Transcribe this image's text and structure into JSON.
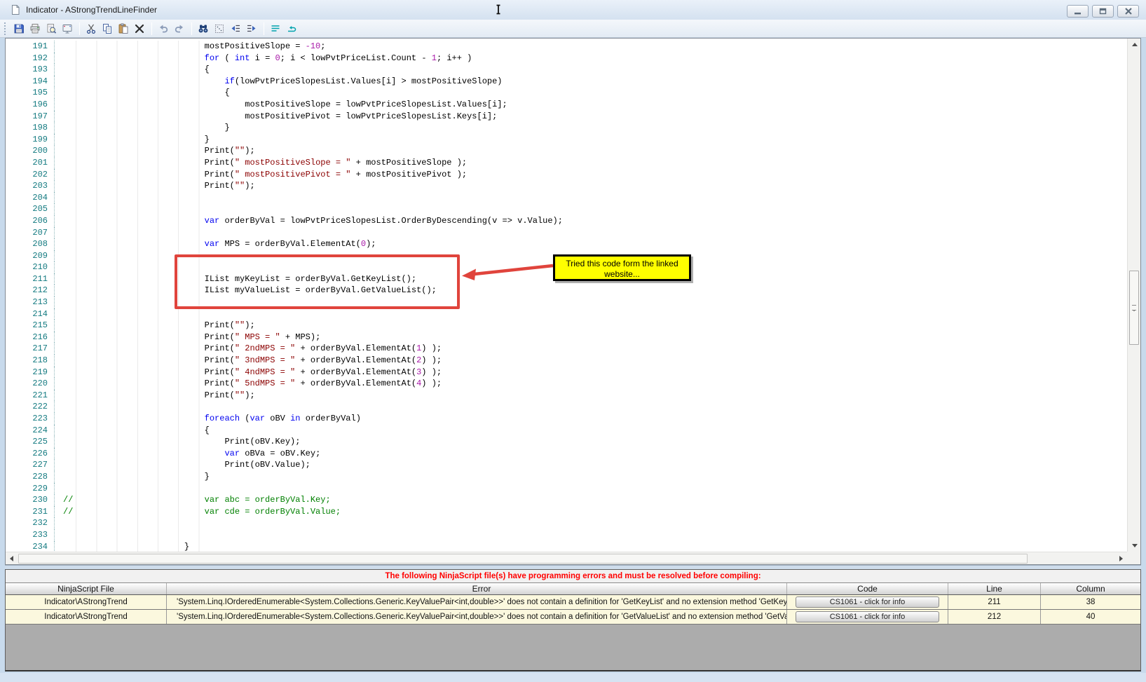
{
  "window": {
    "title": "Indicator - AStrongTrendLineFinder"
  },
  "toolbar": {
    "icons": [
      "save",
      "print",
      "print-preview",
      "board",
      "cut",
      "copy",
      "paste",
      "delete",
      "undo",
      "redo",
      "find",
      "select-special",
      "outdent",
      "indent",
      "align-lines",
      "wrap-return"
    ]
  },
  "editor": {
    "first_visible_line": 191,
    "last_visible_line": 234,
    "lines": [
      {
        "n": "191",
        "s": [
          [
            "p",
            "                            mostPositiveSlope = "
          ],
          [
            "n",
            "-10"
          ],
          [
            "p",
            ";"
          ]
        ]
      },
      {
        "n": "192",
        "s": [
          [
            "p",
            "                            "
          ],
          [
            "k",
            "for"
          ],
          [
            "p",
            " ( "
          ],
          [
            "k",
            "int"
          ],
          [
            "p",
            " i = "
          ],
          [
            "n",
            "0"
          ],
          [
            "p",
            "; i < lowPvtPriceList.Count - "
          ],
          [
            "n",
            "1"
          ],
          [
            "p",
            "; i++ )"
          ]
        ]
      },
      {
        "n": "193",
        "s": [
          [
            "p",
            "                            {"
          ]
        ]
      },
      {
        "n": "194",
        "s": [
          [
            "p",
            "                                "
          ],
          [
            "k",
            "if"
          ],
          [
            "p",
            "(lowPvtPriceSlopesList.Values[i] > mostPositiveSlope)"
          ]
        ]
      },
      {
        "n": "195",
        "s": [
          [
            "p",
            "                                {"
          ]
        ]
      },
      {
        "n": "196",
        "s": [
          [
            "p",
            "                                    mostPositiveSlope = lowPvtPriceSlopesList.Values[i];"
          ]
        ]
      },
      {
        "n": "197",
        "s": [
          [
            "p",
            "                                    mostPositivePivot = lowPvtPriceSlopesList.Keys[i];"
          ]
        ]
      },
      {
        "n": "198",
        "s": [
          [
            "p",
            "                                }"
          ]
        ]
      },
      {
        "n": "199",
        "s": [
          [
            "p",
            "                            }"
          ]
        ]
      },
      {
        "n": "200",
        "s": [
          [
            "p",
            "                            Print("
          ],
          [
            "s",
            "\"\""
          ],
          [
            "p",
            ");"
          ]
        ]
      },
      {
        "n": "201",
        "s": [
          [
            "p",
            "                            Print("
          ],
          [
            "s",
            "\" mostPositiveSlope = \""
          ],
          [
            "p",
            " + mostPositiveSlope );"
          ]
        ]
      },
      {
        "n": "202",
        "s": [
          [
            "p",
            "                            Print("
          ],
          [
            "s",
            "\" mostPositivePivot = \""
          ],
          [
            "p",
            " + mostPositivePivot );"
          ]
        ]
      },
      {
        "n": "203",
        "s": [
          [
            "p",
            "                            Print("
          ],
          [
            "s",
            "\"\""
          ],
          [
            "p",
            ");"
          ]
        ]
      },
      {
        "n": "204",
        "s": []
      },
      {
        "n": "205",
        "s": []
      },
      {
        "n": "206",
        "s": [
          [
            "p",
            "                            "
          ],
          [
            "k",
            "var"
          ],
          [
            "p",
            " orderByVal = lowPvtPriceSlopesList.OrderByDescending(v => v.Value);"
          ]
        ]
      },
      {
        "n": "207",
        "s": []
      },
      {
        "n": "208",
        "s": [
          [
            "p",
            "                            "
          ],
          [
            "k",
            "var"
          ],
          [
            "p",
            " MPS = orderByVal.ElementAt("
          ],
          [
            "n",
            "0"
          ],
          [
            "p",
            ");"
          ]
        ]
      },
      {
        "n": "209",
        "s": []
      },
      {
        "n": "210",
        "s": []
      },
      {
        "n": "211",
        "s": [
          [
            "p",
            "                            IList myKeyList = orderByVal.GetKeyList();"
          ]
        ]
      },
      {
        "n": "212",
        "s": [
          [
            "p",
            "                            IList myValueList = orderByVal.GetValueList();"
          ]
        ]
      },
      {
        "n": "213",
        "s": []
      },
      {
        "n": "214",
        "s": []
      },
      {
        "n": "215",
        "s": [
          [
            "p",
            "                            Print("
          ],
          [
            "s",
            "\"\""
          ],
          [
            "p",
            ");"
          ]
        ]
      },
      {
        "n": "216",
        "s": [
          [
            "p",
            "                            Print("
          ],
          [
            "s",
            "\" MPS = \""
          ],
          [
            "p",
            " + MPS);"
          ]
        ]
      },
      {
        "n": "217",
        "s": [
          [
            "p",
            "                            Print("
          ],
          [
            "s",
            "\" 2ndMPS = \""
          ],
          [
            "p",
            " + orderByVal.ElementAt("
          ],
          [
            "n",
            "1"
          ],
          [
            "p",
            ") );"
          ]
        ]
      },
      {
        "n": "218",
        "s": [
          [
            "p",
            "                            Print("
          ],
          [
            "s",
            "\" 3ndMPS = \""
          ],
          [
            "p",
            " + orderByVal.ElementAt("
          ],
          [
            "n",
            "2"
          ],
          [
            "p",
            ") );"
          ]
        ]
      },
      {
        "n": "219",
        "s": [
          [
            "p",
            "                            Print("
          ],
          [
            "s",
            "\" 4ndMPS = \""
          ],
          [
            "p",
            " + orderByVal.ElementAt("
          ],
          [
            "n",
            "3"
          ],
          [
            "p",
            ") );"
          ]
        ]
      },
      {
        "n": "220",
        "s": [
          [
            "p",
            "                            Print("
          ],
          [
            "s",
            "\" 5ndMPS = \""
          ],
          [
            "p",
            " + orderByVal.ElementAt("
          ],
          [
            "n",
            "4"
          ],
          [
            "p",
            ") );"
          ]
        ]
      },
      {
        "n": "221",
        "s": [
          [
            "p",
            "                            Print("
          ],
          [
            "s",
            "\"\""
          ],
          [
            "p",
            ");"
          ]
        ]
      },
      {
        "n": "222",
        "s": []
      },
      {
        "n": "223",
        "s": [
          [
            "p",
            "                            "
          ],
          [
            "k",
            "foreach"
          ],
          [
            "p",
            " ("
          ],
          [
            "k",
            "var"
          ],
          [
            "p",
            " oBV "
          ],
          [
            "k",
            "in"
          ],
          [
            "p",
            " orderByVal)"
          ]
        ]
      },
      {
        "n": "224",
        "s": [
          [
            "p",
            "                            {"
          ]
        ]
      },
      {
        "n": "225",
        "s": [
          [
            "p",
            "                                Print(oBV.Key);"
          ]
        ]
      },
      {
        "n": "226",
        "s": [
          [
            "p",
            "                                "
          ],
          [
            "k",
            "var"
          ],
          [
            "p",
            " oBVa = oBV.Key;"
          ]
        ]
      },
      {
        "n": "227",
        "s": [
          [
            "p",
            "                                Print(oBV.Value);"
          ]
        ]
      },
      {
        "n": "228",
        "s": [
          [
            "p",
            "                            }"
          ]
        ]
      },
      {
        "n": "229",
        "s": []
      },
      {
        "n": "230",
        "s": [
          [
            "c",
            "//                          var abc = orderByVal.Key;"
          ]
        ]
      },
      {
        "n": "231",
        "s": [
          [
            "c",
            "//                          var cde = orderByVal.Value;"
          ]
        ]
      },
      {
        "n": "232",
        "s": []
      },
      {
        "n": "233",
        "s": []
      },
      {
        "n": "234",
        "s": [
          [
            "p",
            "                        }"
          ]
        ]
      }
    ]
  },
  "annotations": {
    "callout_line1": "Tried this code form the linked",
    "callout_line2": "website...",
    "callout_bg": "#FFFF00",
    "highlight_color": "#E0443C",
    "highlighted_lines": "211-212"
  },
  "error_panel": {
    "header": "The following NinjaScript file(s) have programming errors and must be resolved before compiling:",
    "header_color": "#FF0000",
    "columns": [
      "NinjaScript File",
      "Error",
      "Code",
      "Line",
      "Column"
    ],
    "rows": [
      {
        "file": "Indicator\\AStrongTrend",
        "error": "'System.Linq.IOrderedEnumerable<System.Collections.Generic.KeyValuePair<int,double>>' does not contain a definition for 'GetKeyList' and no extension method 'GetKeyList' accepting a first ar",
        "code": "CS1061 - click for info",
        "line": "211",
        "column": "38"
      },
      {
        "file": "Indicator\\AStrongTrend",
        "error": "'System.Linq.IOrderedEnumerable<System.Collections.Generic.KeyValuePair<int,double>>' does not contain a definition for 'GetValueList' and no extension method 'GetValueList' accepting a firs",
        "code": "CS1061 - click for info",
        "line": "212",
        "column": "40"
      }
    ]
  },
  "colors": {
    "keyword": "#0000F0",
    "string": "#8B0000",
    "number": "#A818A8",
    "comment": "#008000",
    "line_number": "#137A80",
    "row_bg": "#FBF8DE"
  }
}
